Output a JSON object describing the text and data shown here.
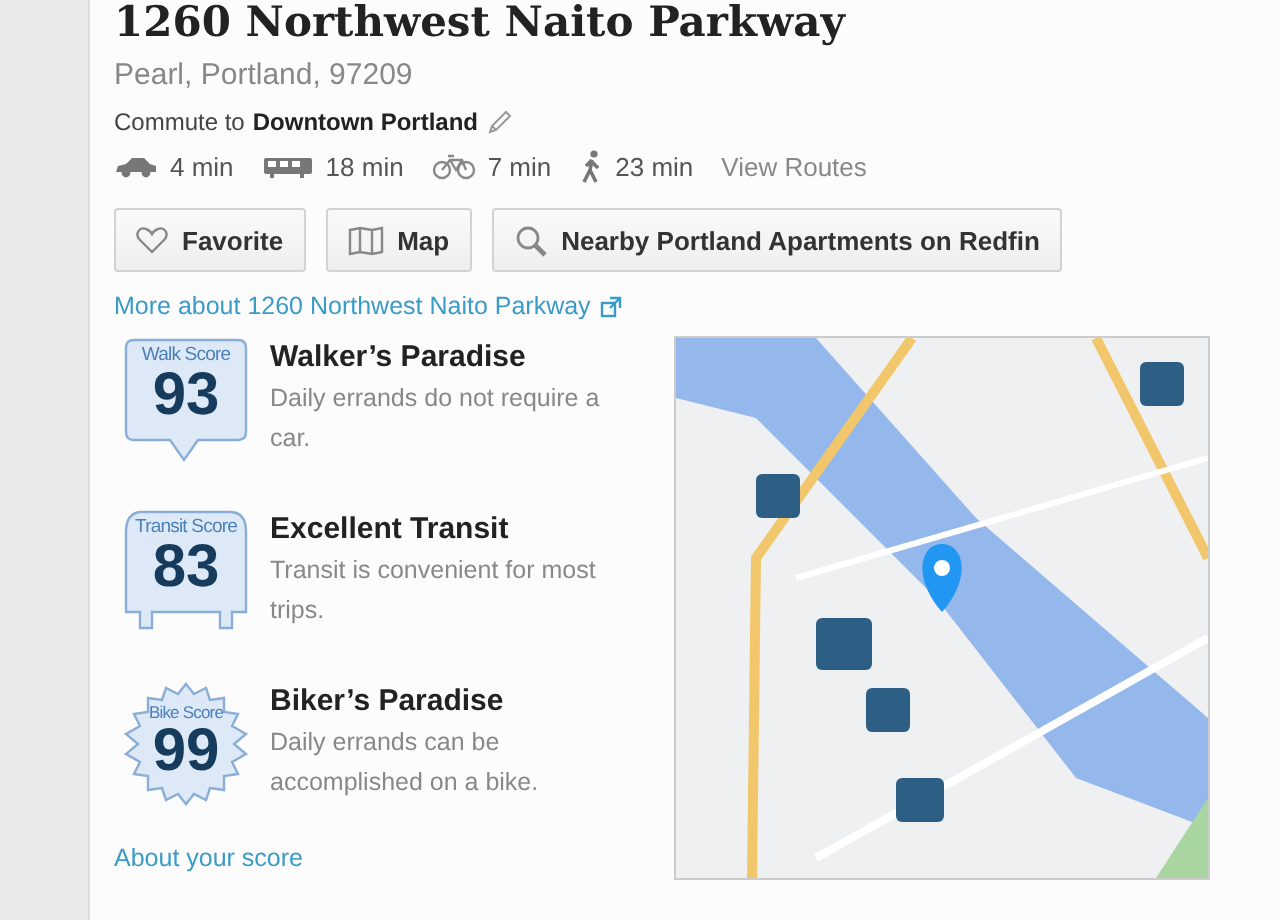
{
  "title": "1260 Northwest Naito Parkway",
  "address": "Pearl, Portland, 97209",
  "commute": {
    "label": "Commute to",
    "destination": "Downtown Portland"
  },
  "modes": [
    {
      "kind": "car",
      "time": "4 min"
    },
    {
      "kind": "bus",
      "time": "18 min"
    },
    {
      "kind": "bike",
      "time": "7 min"
    },
    {
      "kind": "walk",
      "time": "23 min"
    }
  ],
  "view_routes": "View Routes",
  "buttons": [
    {
      "kind": "favorite",
      "label": "Favorite"
    },
    {
      "kind": "map",
      "label": "Map"
    },
    {
      "kind": "search",
      "label": "Nearby Portland Apartments on Redfin"
    }
  ],
  "more_link": "More about 1260 Northwest Naito Parkway",
  "scores": [
    {
      "kind": "walk",
      "badge_label": "Walk Score",
      "value": "93",
      "title": "Walker’s Paradise",
      "description": "Daily errands do not require a car."
    },
    {
      "kind": "transit",
      "badge_label": "Transit Score",
      "value": "83",
      "title": "Excellent Transit",
      "description": "Transit is convenient for most trips."
    },
    {
      "kind": "bike",
      "badge_label": "Bike Score",
      "value": "99",
      "title": "Biker’s Paradise",
      "description": "Daily errands can be accomplished on a bike."
    }
  ],
  "about_link": "About your score"
}
